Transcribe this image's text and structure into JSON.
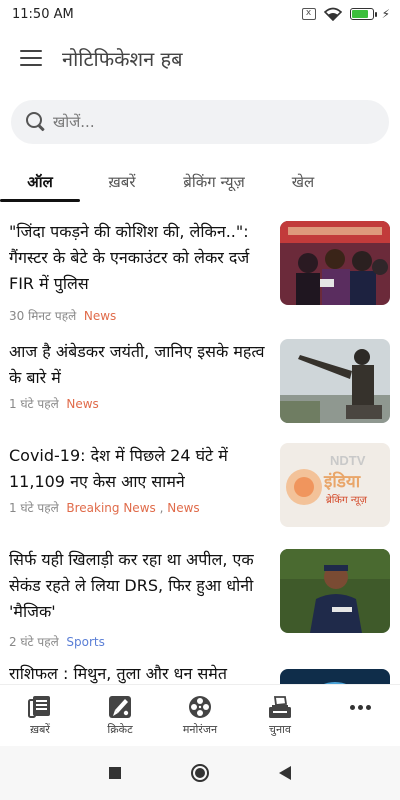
{
  "status_bar": {
    "time": "11:50 AM",
    "sim_icon": "x",
    "icons": [
      "sim-off-icon",
      "wifi-icon",
      "battery-icon",
      "charging-bolt-icon"
    ],
    "battery_level": 0.8
  },
  "app_bar": {
    "title": "नोटिफिकेशन हब",
    "menu_icon": "hamburger-menu-icon"
  },
  "search": {
    "placeholder": "खोजें...",
    "value": "",
    "icon": "search-icon"
  },
  "tabs": [
    {
      "label": "ऑल",
      "active": true
    },
    {
      "label": "ख़बरें",
      "active": false
    },
    {
      "label": "ब्रेकिंग न्यूज़",
      "active": false
    },
    {
      "label": "खेल",
      "active": false
    }
  ],
  "news": [
    {
      "headline": "\"जिंदा पकड़ने की कोशिश की, लेकिन..\": गैंगस्टर के बेटे के एनकाउंटर को लेकर दर्ज FIR में पुलिस",
      "time": "30 मिनट पहले",
      "categories": [
        "News"
      ],
      "thumbnail": "protest-crowd-image"
    },
    {
      "headline": "आज है अंबेडकर जयंती, जानिए इसके महत्व के बारे में",
      "time": "1 घंटे पहले",
      "categories": [
        "News"
      ],
      "thumbnail": "ambedkar-statue-image"
    },
    {
      "headline": "Covid-19: देश में पिछले 24 घंटे में 11,109 नए केस आए सामने",
      "time": "1 घंटे पहले",
      "categories": [
        "Breaking News",
        "News"
      ],
      "thumbnail": "ndtv-india-breaking-news-image",
      "thumbnail_text": [
        "NDTV",
        "इंडिया",
        "ब्रेकिंग न्यूज़"
      ]
    },
    {
      "headline": "सिर्फ यही खिलाड़ी कर रहा था अपील, एक सेकंड रहते ले लिया DRS, फिर हुआ धोनी 'मैजिक'",
      "time": "2 घंटे पहले",
      "categories": [
        "Sports"
      ],
      "thumbnail": "cricket-player-image"
    },
    {
      "headline": "राशिफल : मिथुन, तुला और धन समेत",
      "time": "",
      "categories": [],
      "thumbnail": "zodiac-image"
    }
  ],
  "bottom_nav": [
    {
      "label": "ख़बरें",
      "icon": "newspaper-icon"
    },
    {
      "label": "क्रिकेट",
      "icon": "cricket-bat-icon"
    },
    {
      "label": "मनोरंजन",
      "icon": "film-reel-icon"
    },
    {
      "label": "चुनाव",
      "icon": "ballot-box-icon"
    },
    {
      "label": "",
      "icon": "more-icon"
    }
  ],
  "system_nav": [
    "recents-square-icon",
    "home-circle-icon",
    "back-triangle-icon"
  ],
  "colors": {
    "accent_source": "#e06b4a",
    "sports_source": "#5b7fd6",
    "search_bg": "#f1f2f4",
    "battery_green": "#3cbf3c"
  }
}
